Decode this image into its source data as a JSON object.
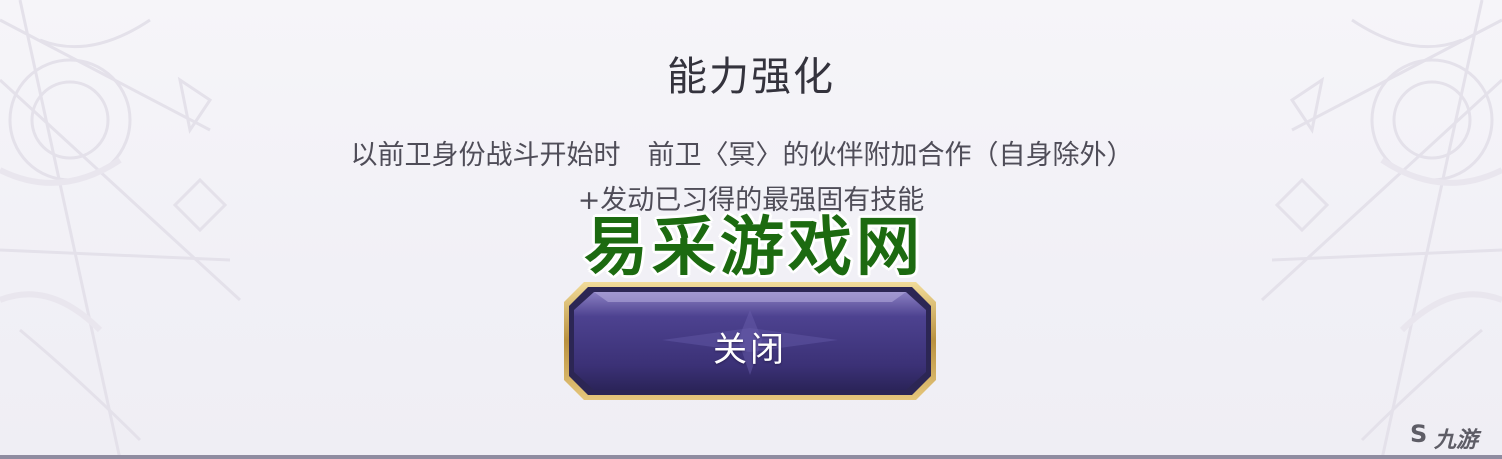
{
  "dialog": {
    "title": "能力强化",
    "description_line1": "以前卫身份战斗开始时　前卫〈冥〉的伙伴附加合作（自身除外）",
    "description_line2": "+发动已习得的最强固有技能",
    "close_label": "关闭"
  },
  "watermark": {
    "text": "易采游戏网"
  },
  "brand": {
    "icon": "S",
    "text": "九游"
  },
  "colors": {
    "background": "#f3f2f7",
    "button_fill": "#4a3f86",
    "button_border": "#c9a95a",
    "watermark": "#1c6a10"
  }
}
